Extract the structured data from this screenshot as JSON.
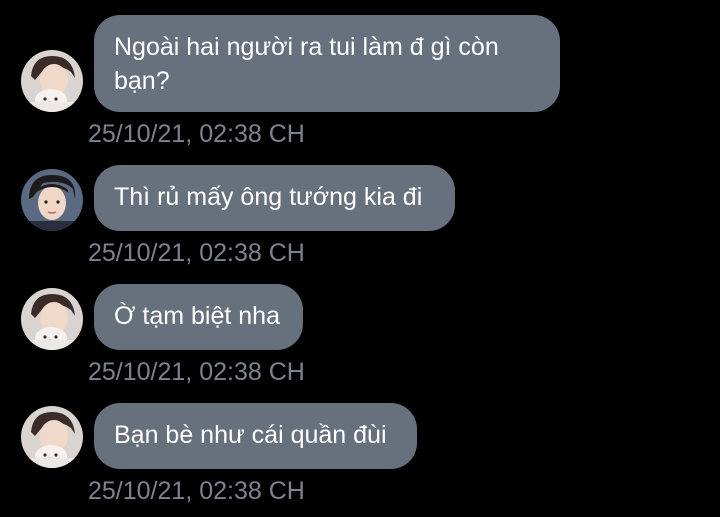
{
  "messages": [
    {
      "text": "Ngoài hai người ra tui làm đ gì còn bạn?",
      "time": "25/10/21, 02:38 CH",
      "avatar": "avatar-a"
    },
    {
      "text": "Thì rủ mấy ông tướng kia đi",
      "time": "25/10/21, 02:38 CH",
      "avatar": "avatar-b"
    },
    {
      "text": "Ờ tạm biệt nha",
      "time": "25/10/21, 02:38 CH",
      "avatar": "avatar-a"
    },
    {
      "text": "Bạn bè như cái quần đùi",
      "time": "25/10/21, 02:38 CH",
      "avatar": "avatar-a"
    }
  ],
  "colors": {
    "background": "#000000",
    "bubble": "#67717d",
    "bubble_text": "#ffffff",
    "timestamp": "#7a848f"
  }
}
